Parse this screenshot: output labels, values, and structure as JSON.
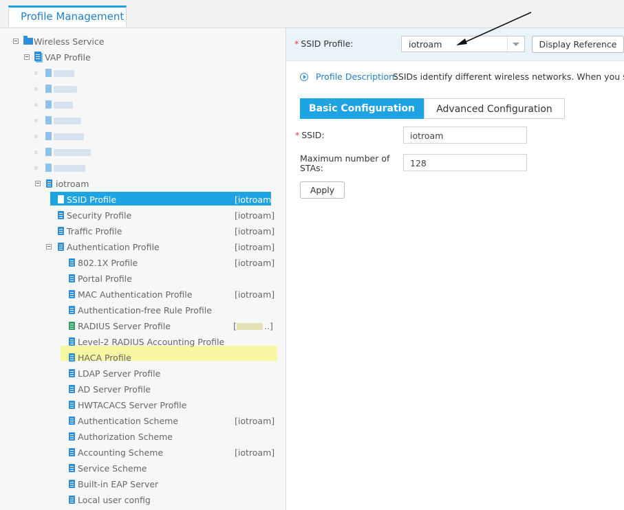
{
  "tab": {
    "label": "Profile Management"
  },
  "tree": {
    "root": "Wireless Service",
    "vap": "VAP Profile",
    "iotroam": "iotroam",
    "items": [
      {
        "label": "SSID Profile",
        "ref": "[iotroam]"
      },
      {
        "label": "Security Profile",
        "ref": "[iotroam]"
      },
      {
        "label": "Traffic Profile",
        "ref": "[iotroam]"
      },
      {
        "label": "Authentication Profile",
        "ref": "[iotroam]"
      }
    ],
    "auth_children": [
      {
        "label": "802.1X Profile",
        "ref": "[iotroam]"
      },
      {
        "label": "Portal Profile",
        "ref": ""
      },
      {
        "label": "MAC Authentication Profile",
        "ref": "[iotroam]"
      },
      {
        "label": "Authentication-free Rule Profile",
        "ref": ""
      },
      {
        "label": "RADIUS Server Profile",
        "ref": "[",
        "ref_suffix": "..]"
      },
      {
        "label": "Level-2 RADIUS Accounting Profile",
        "ref": ""
      },
      {
        "label": "HACA Profile",
        "ref": ""
      },
      {
        "label": "LDAP Server Profile",
        "ref": ""
      },
      {
        "label": "AD Server Profile",
        "ref": ""
      },
      {
        "label": "HWTACACS Server Profile",
        "ref": ""
      },
      {
        "label": "Authentication Scheme",
        "ref": "[iotroam]"
      },
      {
        "label": "Authorization Scheme",
        "ref": ""
      },
      {
        "label": "Accounting Scheme",
        "ref": "[iotroam]"
      },
      {
        "label": "Service Scheme",
        "ref": ""
      },
      {
        "label": "Built-in EAP Server",
        "ref": ""
      },
      {
        "label": "Local user config",
        "ref": ""
      }
    ]
  },
  "header": {
    "required_mark": "*",
    "ssid_profile_label": "SSID Profile:",
    "ssid_profile_value": "iotroam",
    "display_reference": "Display Reference"
  },
  "description": {
    "label": "Profile Description:",
    "text": "SSIDs identify different wireless networks. When you search"
  },
  "config_tabs": {
    "basic": "Basic Configuration",
    "advanced": "Advanced Configuration"
  },
  "form": {
    "ssid_label": "SSID:",
    "ssid_value": "iotroam",
    "max_sta_label_line1": "Maximum number of",
    "max_sta_label_line2": "STAs:",
    "max_sta_value": "128",
    "apply": "Apply"
  }
}
